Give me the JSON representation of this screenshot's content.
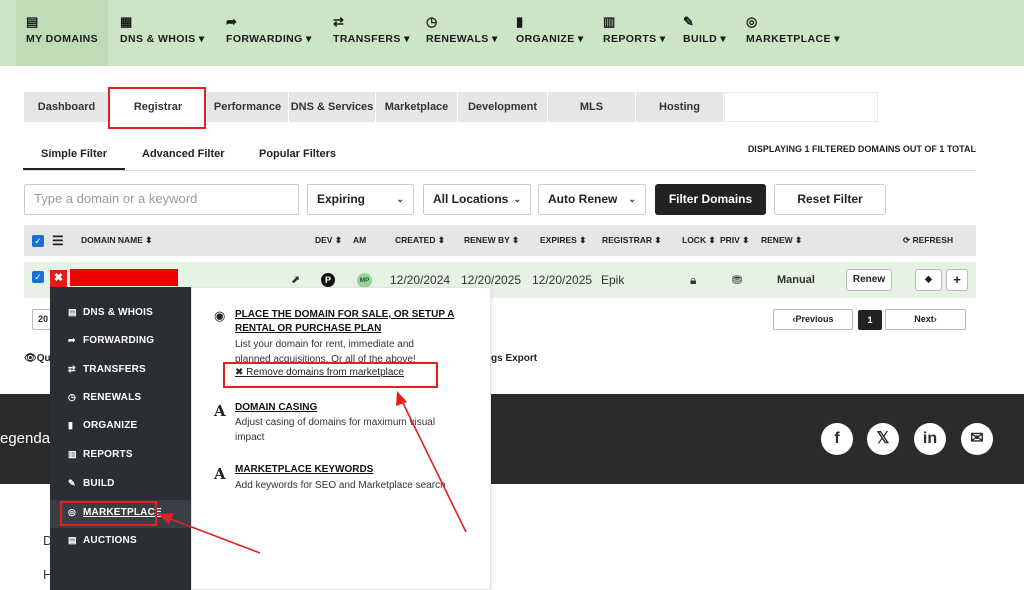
{
  "nav": {
    "items": [
      {
        "label": "MY DOMAINS",
        "icon": "▤"
      },
      {
        "label": "DNS & WHOIS ▾",
        "icon": "▦"
      },
      {
        "label": "FORWARDING ▾",
        "icon": "➦"
      },
      {
        "label": "TRANSFERS ▾",
        "icon": "⇄"
      },
      {
        "label": "RENEWALS ▾",
        "icon": "◷"
      },
      {
        "label": "ORGANIZE ▾",
        "icon": "▮"
      },
      {
        "label": "REPORTS ▾",
        "icon": "▥"
      },
      {
        "label": "BUILD ▾",
        "icon": "✎"
      },
      {
        "label": "MARKETPLACE ▾",
        "icon": "◎"
      }
    ]
  },
  "tabs": [
    "Dashboard",
    "Registrar",
    "Performance",
    "DNS & Services",
    "Marketplace",
    "Development",
    "MLS",
    "Hosting"
  ],
  "filter_tabs": [
    "Simple Filter",
    "Advanced Filter",
    "Popular Filters"
  ],
  "display_count": "DISPLAYING 1 FILTERED DOMAINS OUT OF 1 TOTAL",
  "filters": {
    "search_placeholder": "Type a domain or a keyword",
    "expiring": "Expiring",
    "locations": "All Locations",
    "auto_renew": "Auto Renew",
    "filter_btn": "Filter Domains",
    "reset_btn": "Reset Filter"
  },
  "table": {
    "headers": {
      "domain": "DOMAIN NAME ⬍",
      "dev": "DEV ⬍",
      "am": "AM",
      "created": "CREATED ⬍",
      "renew_by": "RENEW BY ⬍",
      "expires": "EXPIRES ⬍",
      "registrar": "REGISTRAR ⬍",
      "lock": "LOCK ⬍",
      "priv": "PRIV ⬍",
      "renew": "RENEW ⬍",
      "refresh": "⟳ REFRESH"
    },
    "row": {
      "p_badge": "P",
      "mp_badge": "MP",
      "created": "12/20/2024",
      "renew_by": "12/20/2025",
      "expires": "12/20/2025",
      "registrar": "Epik",
      "renew_mode": "Manual",
      "renew_btn": "Renew"
    }
  },
  "pagination": {
    "per_page": "20",
    "previous": "‹Previous",
    "page": "1",
    "next": "Next›"
  },
  "bottom": {
    "quick": "Qu",
    "export": "gs Export"
  },
  "footer": {
    "text": "egenda"
  },
  "socials": [
    "f",
    "𝕏",
    "in",
    "✉"
  ],
  "dropdown": {
    "menu": [
      {
        "label": "DNS & WHOIS",
        "icon": "▤"
      },
      {
        "label": "FORWARDING",
        "icon": "➦"
      },
      {
        "label": "TRANSFERS",
        "icon": "⇄"
      },
      {
        "label": "RENEWALS",
        "icon": "◷"
      },
      {
        "label": "ORGANIZE",
        "icon": "▮"
      },
      {
        "label": "REPORTS",
        "icon": "▥"
      },
      {
        "label": "BUILD",
        "icon": "✎"
      },
      {
        "label": "MARKETPLACE",
        "icon": "◎"
      },
      {
        "label": "AUCTIONS",
        "icon": "▤"
      }
    ],
    "panel": {
      "item1_title_l1": "PLACE THE DOMAIN FOR SALE, OR SETUP A",
      "item1_title_l2": "RENTAL OR PURCHASE PLAN",
      "item1_desc_l1": "List your domain for rent, immediate and",
      "item1_desc_l2": "planned acquisitions. Or all of the above!",
      "item1_link": "✖ Remove domains from marketplace",
      "item2_title": "DOMAIN CASING",
      "item2_desc_l1": "Adjust casing of domains for maximum visual",
      "item2_desc_l2": "impact",
      "item3_title": "MARKETPLACE KEYWORDS",
      "item3_desc": "Add keywords for SEO and Marketplace search"
    }
  },
  "below": {
    "d": "D",
    "h": "H"
  }
}
